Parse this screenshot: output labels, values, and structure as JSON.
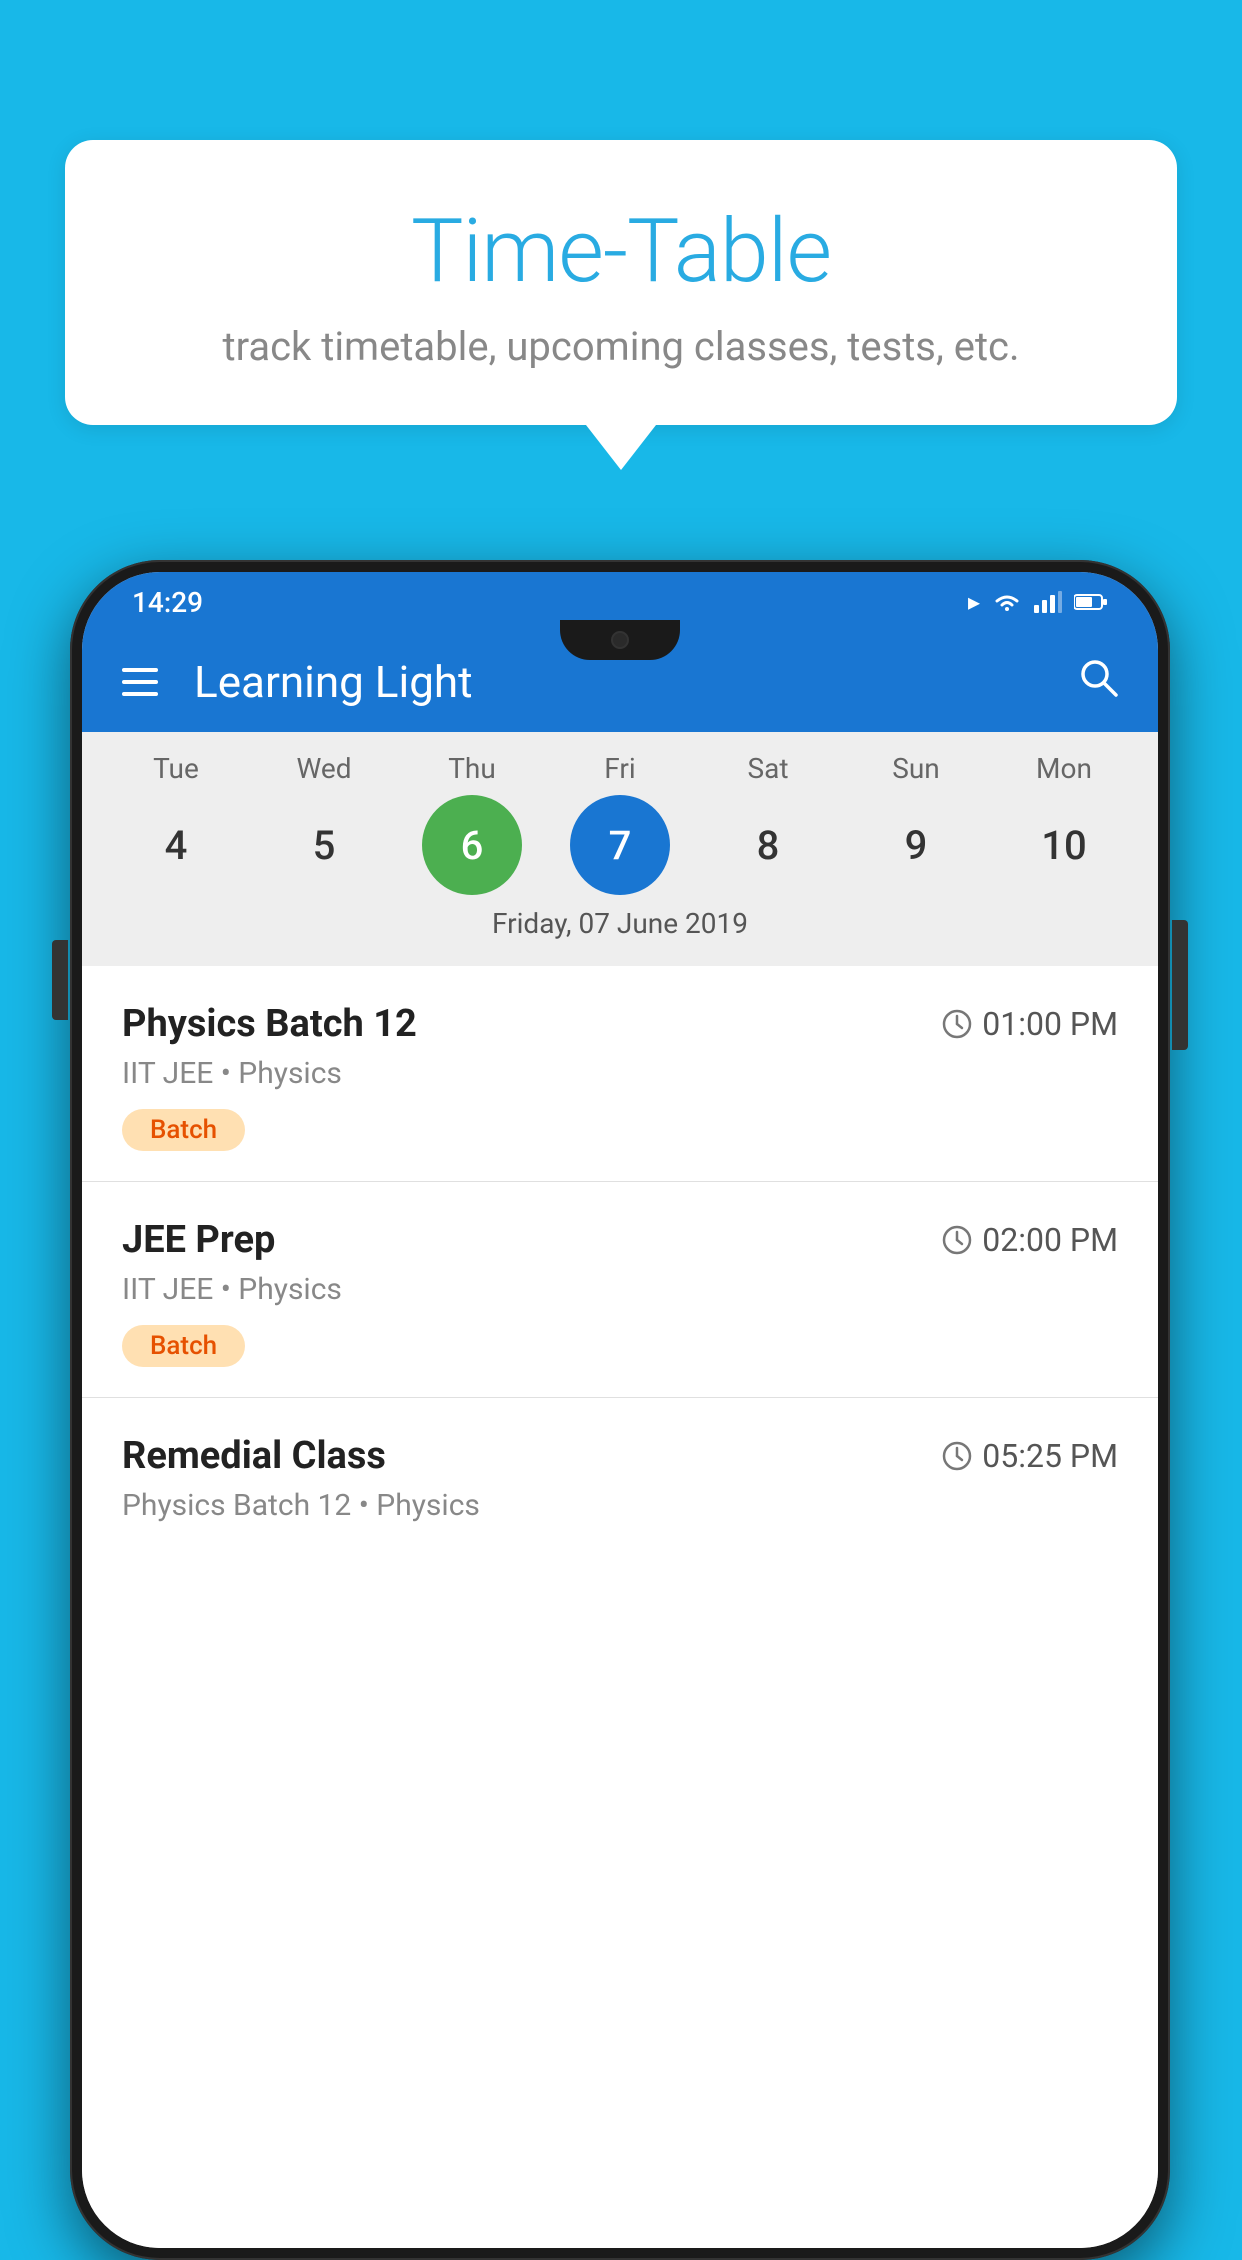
{
  "background_color": "#18B8E8",
  "speech_bubble": {
    "title": "Time-Table",
    "subtitle": "track timetable, upcoming classes, tests, etc."
  },
  "phone": {
    "status_bar": {
      "time": "14:29"
    },
    "app_bar": {
      "title": "Learning Light"
    },
    "calendar": {
      "days": [
        {
          "label": "Tue",
          "number": "4"
        },
        {
          "label": "Wed",
          "number": "5"
        },
        {
          "label": "Thu",
          "number": "6",
          "state": "today"
        },
        {
          "label": "Fri",
          "number": "7",
          "state": "selected"
        },
        {
          "label": "Sat",
          "number": "8"
        },
        {
          "label": "Sun",
          "number": "9"
        },
        {
          "label": "Mon",
          "number": "10"
        }
      ],
      "selected_date": "Friday, 07 June 2019"
    },
    "schedule": [
      {
        "title": "Physics Batch 12",
        "time": "01:00 PM",
        "subtitle": "IIT JEE • Physics",
        "badge": "Batch"
      },
      {
        "title": "JEE Prep",
        "time": "02:00 PM",
        "subtitle": "IIT JEE • Physics",
        "badge": "Batch"
      },
      {
        "title": "Remedial Class",
        "time": "05:25 PM",
        "subtitle": "Physics Batch 12 • Physics",
        "badge": ""
      }
    ]
  }
}
